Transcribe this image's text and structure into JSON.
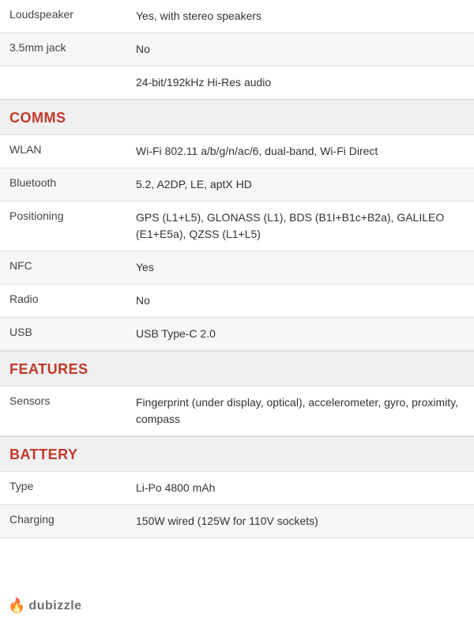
{
  "rows_top": [
    {
      "label": "Loudspeaker",
      "value": "Yes, with stereo speakers",
      "alt": false
    },
    {
      "label": "3.5mm jack",
      "value": "No",
      "alt": true
    },
    {
      "label": "",
      "value": "24-bit/192kHz Hi-Res audio",
      "alt": false
    }
  ],
  "sections": [
    {
      "title": "COMMS",
      "rows": [
        {
          "label": "WLAN",
          "value": "Wi-Fi 802.11 a/b/g/n/ac/6, dual-band, Wi-Fi Direct",
          "alt": false
        },
        {
          "label": "Bluetooth",
          "value": "5.2, A2DP, LE, aptX HD",
          "alt": true
        },
        {
          "label": "Positioning",
          "value": "GPS (L1+L5), GLONASS (L1), BDS (B1I+B1c+B2a), GALILEO (E1+E5a), QZSS (L1+L5)",
          "alt": false
        },
        {
          "label": "NFC",
          "value": "Yes",
          "alt": true
        },
        {
          "label": "Radio",
          "value": "No",
          "alt": false
        },
        {
          "label": "USB",
          "value": "USB Type-C 2.0",
          "alt": true
        }
      ]
    },
    {
      "title": "FEATURES",
      "rows": [
        {
          "label": "Sensors",
          "value": "Fingerprint (under display, optical), accelerometer, gyro, proximity, compass",
          "alt": false
        }
      ]
    },
    {
      "title": "BATTERY",
      "rows": [
        {
          "label": "Type",
          "value": "Li-Po 4800 mAh",
          "alt": false
        },
        {
          "label": "Charging",
          "value": "150W wired (125W for 110V sockets)",
          "alt": true
        }
      ]
    }
  ],
  "watermark": {
    "text": "dubizzle",
    "icon": "🔥"
  }
}
